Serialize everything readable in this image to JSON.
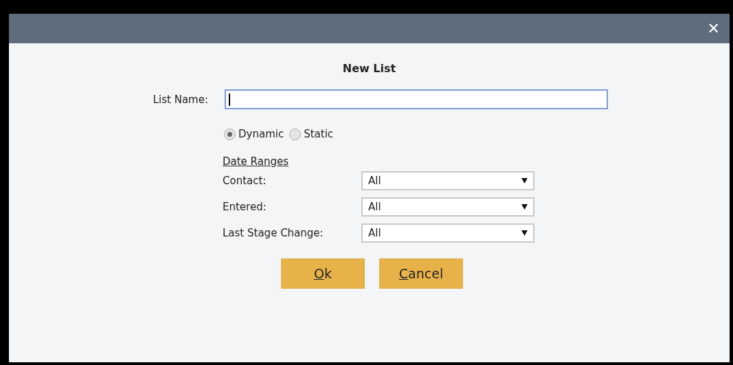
{
  "dialog": {
    "close": "✕",
    "title": "New List"
  },
  "list_name": {
    "label": "List Name:",
    "focused": true
  },
  "list_type": [
    {
      "label": "Dynamic",
      "selected": true
    },
    {
      "label": "Static",
      "selected": false
    }
  ],
  "date_ranges": {
    "heading": "Date Ranges",
    "rows": [
      {
        "label": "Contact:",
        "value": "All"
      },
      {
        "label": "Entered:",
        "value": "All"
      },
      {
        "label": "Last Stage Change:",
        "value": "All"
      }
    ]
  },
  "buttons": [
    {
      "label": "Ok",
      "mnemonic": true
    },
    {
      "label": "Cancel",
      "mnemonic": true
    }
  ]
}
